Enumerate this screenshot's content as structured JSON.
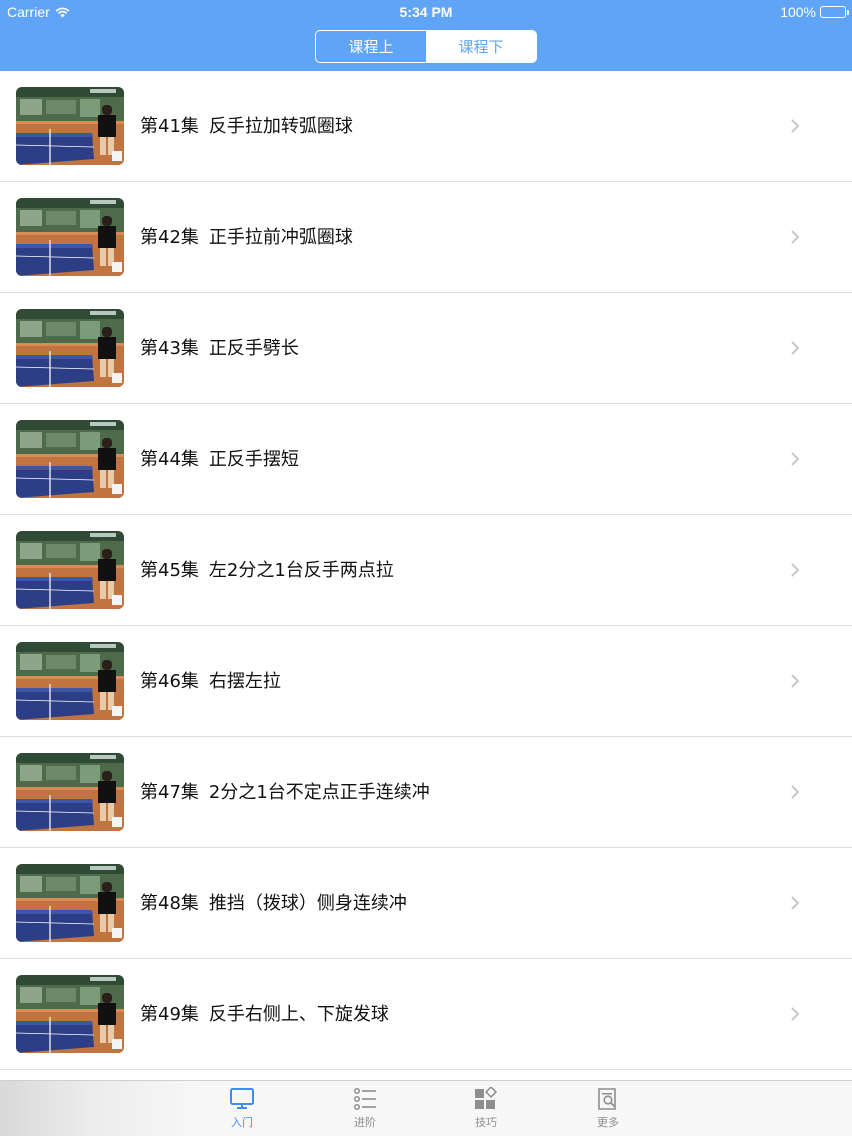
{
  "status_bar": {
    "carrier": "Carrier",
    "time": "5:34 PM",
    "battery": "100%",
    "battery_level": 1.0
  },
  "segmented_control": {
    "options": [
      "课程上",
      "课程下"
    ],
    "selected_index": 1
  },
  "episodes": [
    {
      "ep": "第41集",
      "title": "反手拉加转弧圈球"
    },
    {
      "ep": "第42集",
      "title": "正手拉前冲弧圈球"
    },
    {
      "ep": "第43集",
      "title": "正反手劈长"
    },
    {
      "ep": "第44集",
      "title": "正反手摆短"
    },
    {
      "ep": "第45集",
      "title": "左2分之1台反手两点拉"
    },
    {
      "ep": "第46集",
      "title": "右摆左拉"
    },
    {
      "ep": "第47集",
      "title": "2分之1台不定点正手连续冲"
    },
    {
      "ep": "第48集",
      "title": "推挡（拨球）侧身连续冲"
    },
    {
      "ep": "第49集",
      "title": "反手右侧上、下旋发球"
    }
  ],
  "tab_bar": {
    "tabs": [
      {
        "label": "入门",
        "icon": "monitor-icon"
      },
      {
        "label": "进阶",
        "icon": "list-icon"
      },
      {
        "label": "技巧",
        "icon": "grid-icon"
      },
      {
        "label": "更多",
        "icon": "document-search-icon"
      }
    ],
    "selected_index": 0
  },
  "colors": {
    "accent": "#60a4f6",
    "active_tab": "#3c8ef0",
    "inactive_tab": "#8e8e8e"
  }
}
